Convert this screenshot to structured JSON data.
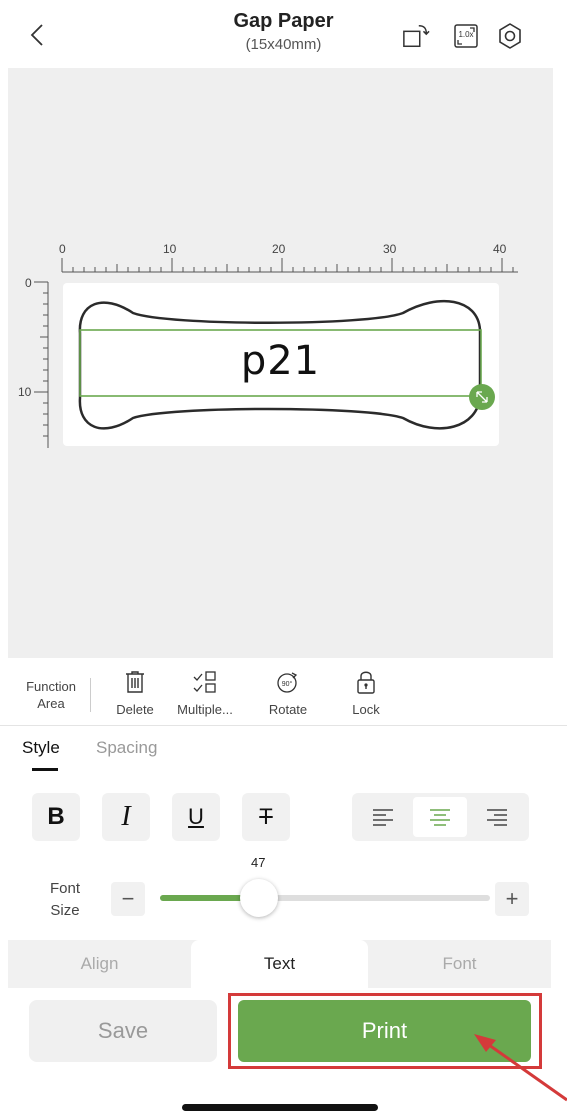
{
  "header": {
    "title": "Gap Paper",
    "subtitle": "(15x40mm)",
    "zoom": "1.0x"
  },
  "canvas": {
    "ruler_top": [
      "0",
      "10",
      "20",
      "30",
      "40"
    ],
    "ruler_left": [
      "0",
      "10"
    ],
    "label_text": "p21"
  },
  "function_area": {
    "label": "Function Area",
    "items": [
      {
        "label": "Delete",
        "icon": "trash-icon"
      },
      {
        "label": "Multiple...",
        "icon": "multi-select-icon"
      },
      {
        "label": "Rotate",
        "icon": "rotate-90-icon"
      },
      {
        "label": "Lock",
        "icon": "lock-icon"
      }
    ]
  },
  "tabs": {
    "style": "Style",
    "spacing": "Spacing"
  },
  "format": {
    "bold": "B",
    "italic": "I",
    "underline": "U",
    "strike": "T"
  },
  "font_size": {
    "label": "Font Size",
    "value": "47",
    "minus": "−",
    "plus": "+",
    "fill_fraction": 0.3
  },
  "bottom_tabs": [
    "Align",
    "Text",
    "Font"
  ],
  "actions": {
    "save": "Save",
    "print": "Print"
  },
  "colors": {
    "accent": "#6aa84f",
    "highlight": "#d43a3a"
  }
}
